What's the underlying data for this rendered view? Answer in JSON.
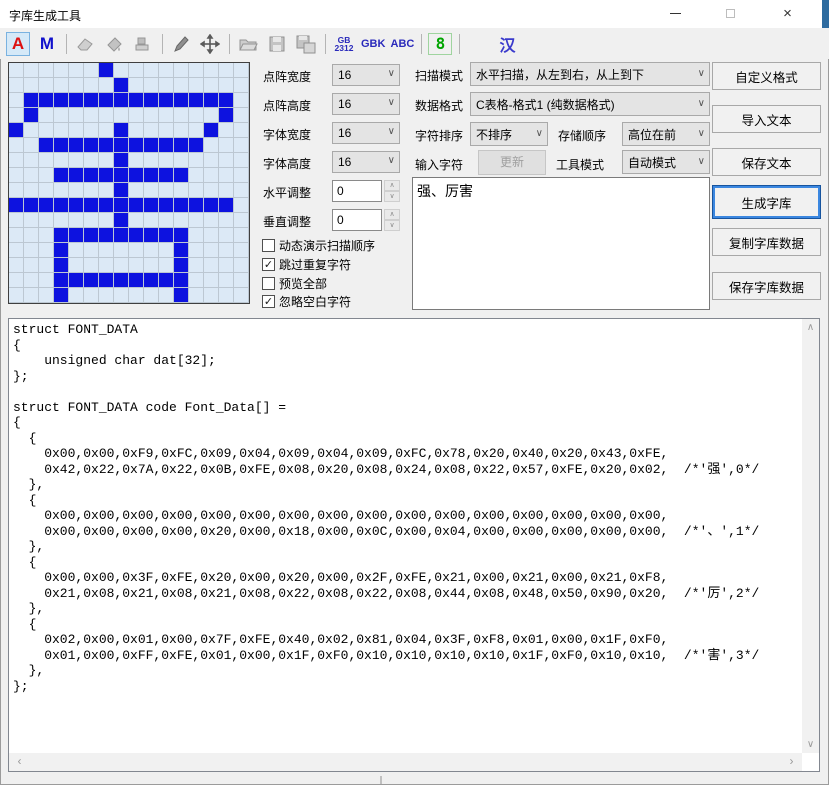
{
  "window": {
    "title": "字库生成工具"
  },
  "toolbar": {
    "btn_a": "A",
    "btn_m": "M",
    "gb2312_top": "GB",
    "gb2312_bottom": "2312",
    "gbk": "GBK",
    "abc": "ABC",
    "digit8": "8",
    "han": "汉"
  },
  "grid": {
    "rows": 16,
    "cols": 16,
    "on_color": "#0d12df",
    "off_color": "#dce9f6",
    "pixels": [
      "0000001000000000",
      "0000000100000000",
      "0111111111111110",
      "0100000000000010",
      "1000000100000100",
      "0011111111111000",
      "0000000100000000",
      "0001111111110000",
      "0000000100000000",
      "1111111111111110",
      "0000000100000000",
      "0001111111110000",
      "0001000000010000",
      "0001000000010000",
      "0001111111110000",
      "0001000000010000"
    ]
  },
  "mid": {
    "rows": [
      {
        "label": "点阵宽度",
        "value": "16"
      },
      {
        "label": "点阵高度",
        "value": "16"
      },
      {
        "label": "字体宽度",
        "value": "16"
      },
      {
        "label": "字体高度",
        "value": "16"
      },
      {
        "label": "水平调整",
        "value": "0"
      },
      {
        "label": "垂直调整",
        "value": "0"
      }
    ],
    "checkboxes": [
      {
        "label": "动态演示扫描顺序",
        "checked": false,
        "mark": ""
      },
      {
        "label": "跳过重复字符",
        "checked": true,
        "mark": "✓"
      },
      {
        "label": "预览全部",
        "checked": false,
        "mark": ""
      },
      {
        "label": "忽略空白字符",
        "checked": true,
        "mark": "✓"
      }
    ]
  },
  "right": {
    "scan_label": "扫描模式",
    "scan_value": "水平扫描，从左到右，从上到下",
    "format_label": "数据格式",
    "format_value": "C表格-格式1 (纯数据格式)",
    "sort_label": "字符排序",
    "sort_value": "不排序",
    "order_label": "存储顺序",
    "order_value": "高位在前",
    "input_label": "输入字符",
    "update_button": "更新",
    "mode_label": "工具模式",
    "mode_value": "自动模式",
    "input_text": "强、厉害"
  },
  "side_buttons": [
    {
      "label": "自定义格式",
      "focused": false
    },
    {
      "label": "导入文本",
      "focused": false
    },
    {
      "label": "保存文本",
      "focused": false
    },
    {
      "label": "生成字库",
      "focused": true
    },
    {
      "label": "复制字库数据",
      "focused": false
    },
    {
      "label": "保存字库数据",
      "focused": false
    }
  ],
  "code": {
    "lines": [
      "struct FONT_DATA",
      "{",
      "    unsigned char dat[32];",
      "};",
      "",
      "struct FONT_DATA code Font_Data[] =",
      "{",
      "  {",
      "    0x00,0x00,0xF9,0xFC,0x09,0x04,0x09,0x04,0x09,0xFC,0x78,0x20,0x40,0x20,0x43,0xFE,",
      "    0x42,0x22,0x7A,0x22,0x0B,0xFE,0x08,0x20,0x08,0x24,0x08,0x22,0x57,0xFE,0x20,0x02,  /*'强',0*/",
      "  },",
      "  {",
      "    0x00,0x00,0x00,0x00,0x00,0x00,0x00,0x00,0x00,0x00,0x00,0x00,0x00,0x00,0x00,0x00,",
      "    0x00,0x00,0x00,0x00,0x20,0x00,0x18,0x00,0x0C,0x00,0x04,0x00,0x00,0x00,0x00,0x00,  /*'、',1*/",
      "  },",
      "  {",
      "    0x00,0x00,0x3F,0xFE,0x20,0x00,0x20,0x00,0x2F,0xFE,0x21,0x00,0x21,0x00,0x21,0xF8,",
      "    0x21,0x08,0x21,0x08,0x21,0x08,0x22,0x08,0x22,0x08,0x44,0x08,0x48,0x50,0x90,0x20,  /*'厉',2*/",
      "  },",
      "  {",
      "    0x02,0x00,0x01,0x00,0x7F,0xFE,0x40,0x02,0x81,0x04,0x3F,0xF8,0x01,0x00,0x1F,0xF0,",
      "    0x01,0x00,0xFF,0xFE,0x01,0x00,0x1F,0xF0,0x10,0x10,0x10,0x10,0x1F,0xF0,0x10,0x10,  /*'害',3*/",
      "  },",
      "};"
    ]
  }
}
